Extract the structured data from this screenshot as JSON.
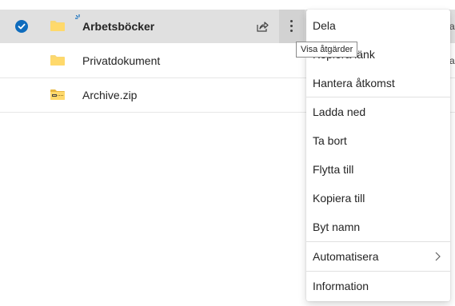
{
  "files": [
    {
      "name": "Arbetsböcker",
      "selected": true,
      "icon": "folder-icon"
    },
    {
      "name": "Privatdokument",
      "selected": false,
      "icon": "folder-icon"
    },
    {
      "name": "Archive.zip",
      "selected": false,
      "icon": "zip-folder-icon"
    }
  ],
  "clipped_text": "al",
  "tooltip": "Visa åtgärder",
  "menu": {
    "items": [
      {
        "label": "Dela"
      },
      {
        "label": "Kopiera länk"
      },
      {
        "label": "Hantera åtkomst"
      },
      {
        "label": "Ladda ned"
      },
      {
        "label": "Ta bort"
      },
      {
        "label": "Flytta till"
      },
      {
        "label": "Kopiera till"
      },
      {
        "label": "Byt namn"
      },
      {
        "label": "Automatisera"
      },
      {
        "label": "Information"
      }
    ]
  },
  "colors": {
    "accent": "#0f6cbd",
    "folder": "#f8d775",
    "selected_row": "#e0e0e0"
  }
}
